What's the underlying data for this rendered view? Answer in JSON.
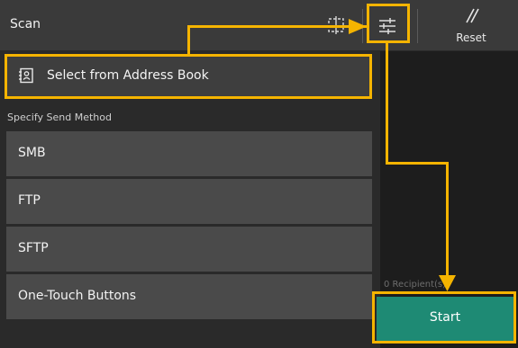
{
  "header": {
    "title": "Scan",
    "frame_icon": "scan-frame-icon",
    "settings_icon": "settings-sliders-icon",
    "reset_icon": "reset-slash-icon",
    "reset_label": "Reset"
  },
  "address_book": {
    "icon": "address-book-icon",
    "label": "Select from Address Book"
  },
  "send_method": {
    "section_label": "Specify Send Method",
    "items": [
      {
        "label": "SMB"
      },
      {
        "label": "FTP"
      },
      {
        "label": "SFTP"
      },
      {
        "label": "One-Touch Buttons"
      }
    ]
  },
  "recipients_text": "0 Recipient(s)",
  "start_label": "Start",
  "colors": {
    "highlight": "#f5b400",
    "start_button": "#1e8a74",
    "header_bg": "#3a3a3a"
  }
}
